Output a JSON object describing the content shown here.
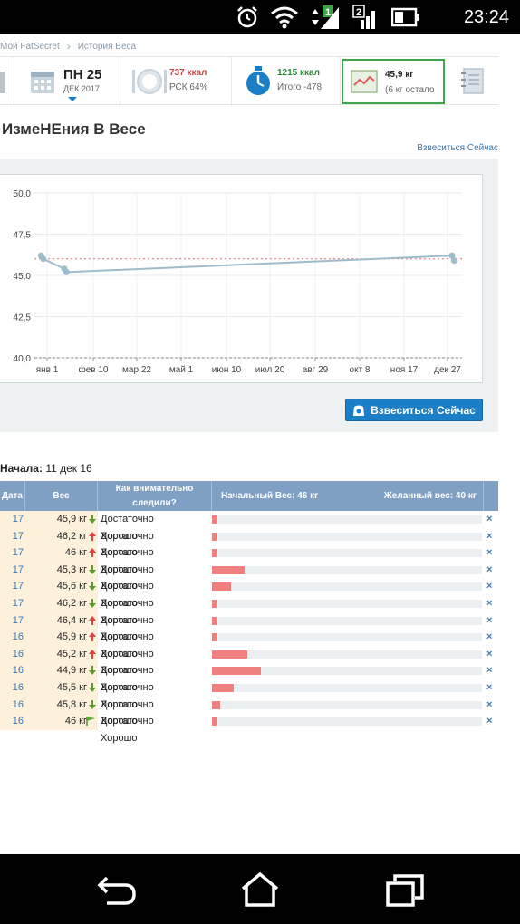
{
  "status": {
    "time": "23:24",
    "sim1_badge": "1",
    "sim2_badge": "2"
  },
  "breadcrumb": {
    "home": "Мой FatSecret",
    "current": "История Веса"
  },
  "tiles": {
    "date": {
      "day": "ПН 25",
      "month": "ДЕК 2017"
    },
    "food": {
      "kcal": "737 ккал",
      "rsk": "РСК 64%"
    },
    "activity": {
      "kcal": "1215 ккал",
      "total": "Итого -478"
    },
    "weight": {
      "value": "45,9 кг",
      "left": "(6 кг остало"
    }
  },
  "page_title": "ИзмеНЕния В Весе",
  "weigh_now_link": "Взвеситься Сейчас",
  "weigh_now_button": "Взвеситься Сейчас",
  "colors": {
    "accent": "#1b7fc7",
    "header": "#7f9fc3",
    "bar": "#f07f7f",
    "line": "#9fbccb",
    "goal_line": "#e07070",
    "down_arrow": "#5a9a2f",
    "up_arrow": "#e04040"
  },
  "chart_data": {
    "type": "line",
    "ylabel": "",
    "ylim": [
      40.0,
      50.0
    ],
    "y_ticks": [
      "50,0",
      "47,5",
      "45,0",
      "42,5",
      "40,0"
    ],
    "x_ticks": [
      "янв 1",
      "фев 10",
      "мар 22",
      "май 1",
      "июн 10",
      "июл 20",
      "авг 29",
      "окт 8",
      "ноя 17",
      "дек 27"
    ],
    "reference_line": 46.0,
    "series": [
      {
        "points": [
          {
            "x": "2016-12-16",
            "y": 46.2
          },
          {
            "x": "2016-12-18",
            "y": 46.0
          },
          {
            "x": "2017-01-06",
            "y": 45.4
          },
          {
            "x": "2017-01-08",
            "y": 45.2
          },
          {
            "x": "2017-12-22",
            "y": 46.2
          },
          {
            "x": "2017-12-24",
            "y": 45.9
          }
        ]
      }
    ]
  },
  "start_info": {
    "label": "Начала:",
    "value": "11 дек 16"
  },
  "table": {
    "headers": {
      "date": "Дата",
      "weight": "Вес",
      "track": "Как внимательно следили?",
      "start": "Начальный Вес: 46 кг",
      "goal": "Желанный вес: 40 кг"
    },
    "rows": [
      {
        "date": "17",
        "weight": "45,9 кг",
        "arrow": "down",
        "track": "Достаточно Хорошо",
        "bar": 0.02,
        "del": "×"
      },
      {
        "date": "17",
        "weight": "46,2 кг",
        "arrow": "up",
        "track": "Достаточно Хорошо",
        "bar": 0.01,
        "del": "×"
      },
      {
        "date": "17",
        "weight": "46 кг",
        "arrow": "up",
        "track": "Достаточно Хорошо",
        "bar": 0.01,
        "del": "×"
      },
      {
        "date": "17",
        "weight": "45,3 кг",
        "arrow": "down",
        "track": "Достаточно Хорошо",
        "bar": 0.12,
        "del": "×"
      },
      {
        "date": "17",
        "weight": "45,6 кг",
        "arrow": "down",
        "track": "Достаточно Хорошо",
        "bar": 0.07,
        "del": "×"
      },
      {
        "date": "17",
        "weight": "46,2 кг",
        "arrow": "down",
        "track": "Достаточно Хорошо",
        "bar": 0.01,
        "del": "×"
      },
      {
        "date": "17",
        "weight": "46,4 кг",
        "arrow": "up",
        "track": "Достаточно Хорошо",
        "bar": 0.01,
        "del": "×"
      },
      {
        "date": "16",
        "weight": "45,9 кг",
        "arrow": "up",
        "track": "Достаточно Хорошо",
        "bar": 0.02,
        "del": "×"
      },
      {
        "date": "16",
        "weight": "45,2 кг",
        "arrow": "up",
        "track": "Достаточно Хорошо",
        "bar": 0.13,
        "del": "×"
      },
      {
        "date": "16",
        "weight": "44,9 кг",
        "arrow": "down",
        "track": "Достаточно Хорошо",
        "bar": 0.18,
        "del": "×"
      },
      {
        "date": "16",
        "weight": "45,5 кг",
        "arrow": "down",
        "track": "Достаточно Хорошо",
        "bar": 0.08,
        "del": "×"
      },
      {
        "date": "16",
        "weight": "45,8 кг",
        "arrow": "down",
        "track": "Достаточно Хорошо",
        "bar": 0.03,
        "del": "×"
      },
      {
        "date": "16",
        "weight": "46 кг",
        "arrow": "flag",
        "track": "Достаточно Хорошо",
        "bar": 0.01,
        "del": "×"
      }
    ]
  }
}
